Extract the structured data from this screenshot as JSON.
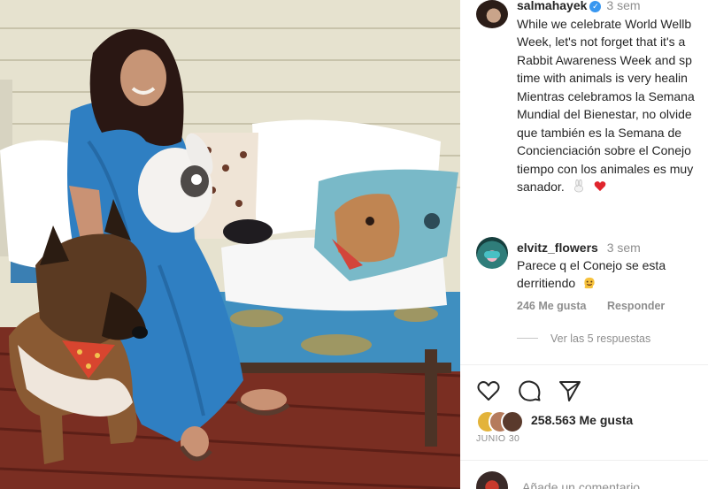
{
  "post": {
    "username": "salmahayek",
    "time": "3 sem",
    "caption_lines": [
      "While we celebrate World Wellb",
      "Week, let's not forget that it's a",
      "Rabbit Awareness Week and sp",
      "time with animals is very healin",
      "Mientras celebramos la Semana",
      "Mundial del Bienestar, no olvide",
      "que también es la Semana de",
      "Concienciación sobre el Conejo",
      "tiempo con los animales es muy",
      "sanador."
    ],
    "caption_emojis": [
      "rabbit-emoji",
      "red-heart-emoji"
    ]
  },
  "comment": {
    "username": "elvitz_flowers",
    "time": "3 sem",
    "lines": [
      "Parece q el Conejo se esta",
      "derritiendo"
    ],
    "emoji": "melting-face-emoji",
    "likes": "246 Me gusta",
    "reply": "Responder",
    "view_replies": "Ver las 5 respuestas"
  },
  "actions": {
    "icons": [
      "heart-icon",
      "comment-icon",
      "share-icon"
    ],
    "likes": "258.563 Me gusta",
    "date": "JUNIO 30"
  },
  "add_comment": {
    "placeholder": "Añade un comentario..."
  },
  "colors": {
    "text": "#262626",
    "muted": "#8e8e8e",
    "verified": "#3897f0",
    "heart": "#ed4956"
  }
}
